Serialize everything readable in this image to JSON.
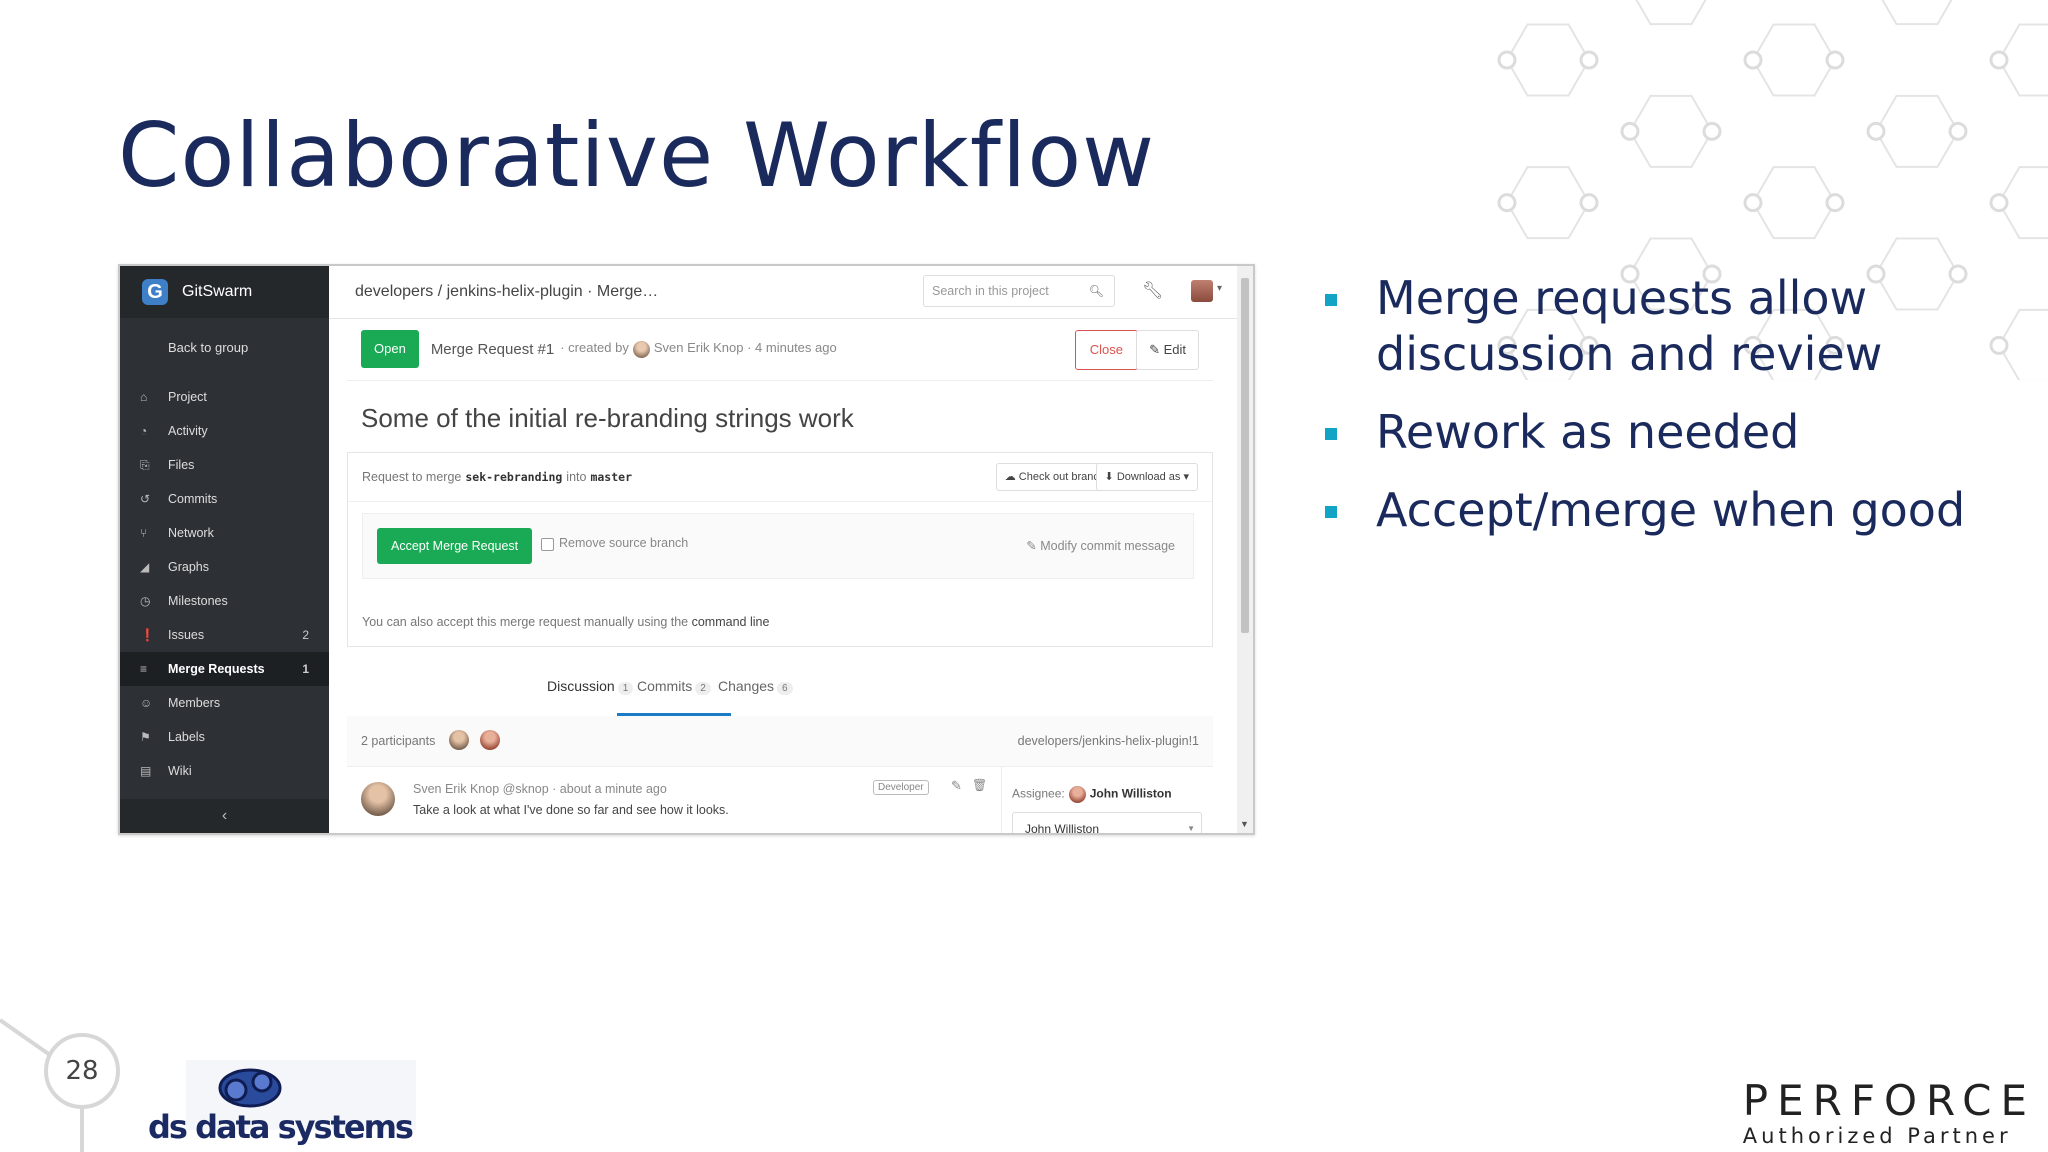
{
  "slide": {
    "title": "Collaborative Workflow",
    "bullets": [
      "Merge requests allow discussion and review",
      "Rework as needed",
      "Accept/merge when good"
    ],
    "page_number": "28",
    "partner_logo": {
      "word": "PERFORCE",
      "sub": "Authorized Partner"
    },
    "company_logo": "ds data systems"
  },
  "app": {
    "brand": "GitSwarm",
    "back_link": "Back to group",
    "nav": [
      {
        "label": "Project",
        "icon": "home-icon",
        "count": ""
      },
      {
        "label": "Activity",
        "icon": "dashboard-icon",
        "count": ""
      },
      {
        "label": "Files",
        "icon": "files-icon",
        "count": ""
      },
      {
        "label": "Commits",
        "icon": "history-icon",
        "count": ""
      },
      {
        "label": "Network",
        "icon": "branch-icon",
        "count": ""
      },
      {
        "label": "Graphs",
        "icon": "area-chart-icon",
        "count": ""
      },
      {
        "label": "Milestones",
        "icon": "clock-icon",
        "count": ""
      },
      {
        "label": "Issues",
        "icon": "exclamation-icon",
        "count": "2"
      },
      {
        "label": "Merge Requests",
        "icon": "list-icon",
        "count": "1",
        "active": true
      },
      {
        "label": "Members",
        "icon": "users-icon",
        "count": ""
      },
      {
        "label": "Labels",
        "icon": "tags-icon",
        "count": ""
      },
      {
        "label": "Wiki",
        "icon": "book-icon",
        "count": ""
      }
    ],
    "collapse": "‹",
    "breadcrumb": "developers / jenkins-helix-plugin · Merge…",
    "search_placeholder": "Search in this project",
    "mr": {
      "status": "Open",
      "id": "Merge Request #1",
      "created_by": "· created by",
      "author": "Sven Erik Knop",
      "time": "· 4 minutes ago",
      "close": "Close",
      "edit": "Edit",
      "title": "Some of the initial re-branding strings work",
      "request_prefix": "Request to merge",
      "source_branch": "sek-rebranding",
      "into": "into",
      "target_branch": "master",
      "checkout": "Check out branch",
      "download": "Download as",
      "accept": "Accept Merge Request",
      "remove_branch": "Remove source branch",
      "modify_msg": "Modify commit message",
      "manual_note": "You can also accept this merge request manually using the",
      "manual_link": "command line"
    },
    "tabs": [
      {
        "label": "Discussion",
        "count": "1"
      },
      {
        "label": "Commits",
        "count": "2"
      },
      {
        "label": "Changes",
        "count": "6"
      }
    ],
    "participants": "2 participants",
    "reference": "developers/jenkins-helix-plugin!1",
    "note": {
      "author": "Sven Erik Knop",
      "meta": "@sknop · about a minute ago",
      "role": "Developer",
      "text": "Take a look at what I've done so far and see how it looks."
    },
    "assignee": {
      "label": "Assignee:",
      "name": "John Williston",
      "select": "John Williston"
    }
  },
  "colors": {
    "title": "#1a2a5c",
    "bullet_marker": "#12a4c4",
    "open_green": "#1aaa55",
    "close_red": "#d9534f",
    "sidebar": "#2d3135"
  }
}
